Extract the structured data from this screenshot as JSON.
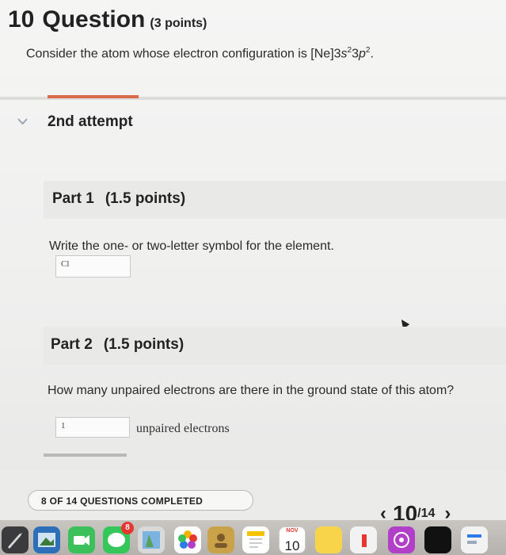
{
  "question": {
    "number": "10",
    "word": "Question",
    "points": "(3 points)",
    "prompt_prefix": "Consider the atom whose electron configuration is [Ne]3",
    "config_s": "s",
    "config_s_exp": "2",
    "config_p_num": "3",
    "config_p": "p",
    "config_p_exp": "2",
    "prompt_suffix": "."
  },
  "attempt": {
    "label": "2nd attempt",
    "chevron": "chevron-down-icon"
  },
  "part1": {
    "title": "Part 1",
    "points": "(1.5 points)",
    "text": "Write the one- or two-letter symbol for the element.",
    "answer_value": "Cl"
  },
  "part2": {
    "title": "Part 2",
    "points": "(1.5 points)",
    "text": "How many unpaired electrons are there in the ground state of this atom?",
    "answer_value": "1",
    "units": "unpaired electrons"
  },
  "progress": {
    "label": "8 OF 14 QUESTIONS COMPLETED"
  },
  "pager": {
    "prev": "‹",
    "current": "10",
    "total": "/14",
    "next": "›"
  },
  "dock": {
    "messages_badge": "8",
    "calendar_month": "NOV",
    "calendar_day": "10"
  },
  "colors": {
    "attempt_accent": "#d96a4a",
    "badge": "#e6362d"
  }
}
